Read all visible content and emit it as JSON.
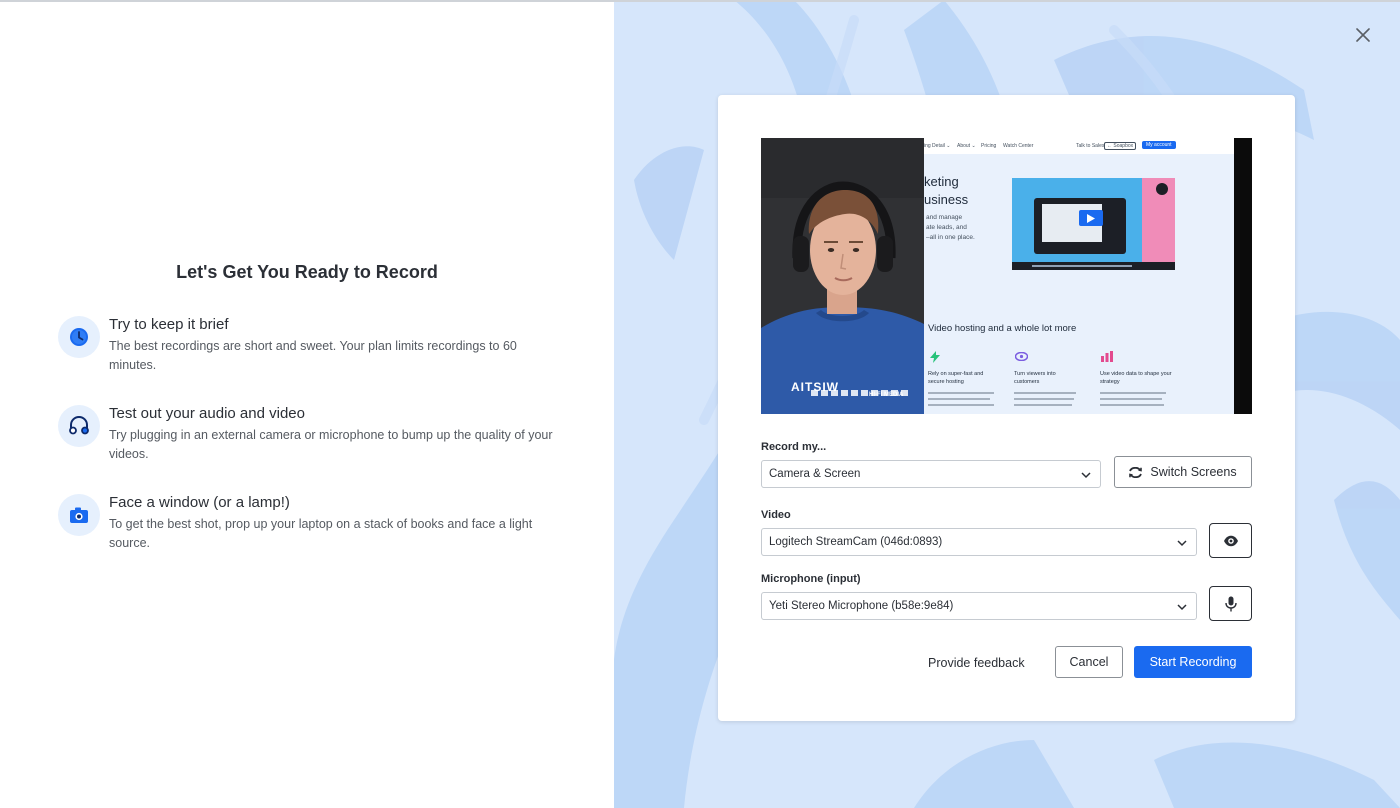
{
  "title": "Let's Get You Ready to Record",
  "tips": [
    {
      "icon": "clock-icon",
      "title": "Try to keep it brief",
      "description": "The best recordings are short and sweet. Your plan limits recordings to 60 minutes."
    },
    {
      "icon": "headphones-icon",
      "title": "Test out your audio and video",
      "description": "Try plugging in an external camera or microphone to bump up the quality of your videos."
    },
    {
      "icon": "camera-icon",
      "title": "Face a window (or a lamp!)",
      "description": "To get the best shot, prop up your laptop on a stack of books and face a light source."
    }
  ],
  "form": {
    "record_label": "Record my...",
    "record_value": "Camera & Screen",
    "switch_screens_label": "Switch Screens",
    "video_label": "Video",
    "video_value": "Logitech StreamCam (046d:0893)",
    "mic_label": "Microphone (input)",
    "mic_value": "Yeti Stereo Microphone (b58e:9e84)"
  },
  "actions": {
    "feedback": "Provide feedback",
    "cancel": "Cancel",
    "start": "Start Recording"
  },
  "preview": {
    "nav": [
      "ing Detail ⌄",
      "About ⌄",
      "Pricing",
      "Watch Center",
      "Talk to Sales",
      "← Soapbox",
      "My account"
    ],
    "headline_1": "keting",
    "headline_2": "usiness",
    "subline_1": "and manage",
    "subline_2": "ate leads, and",
    "subline_3": "–all in one place.",
    "section_title": "Video hosting and a whole lot more",
    "feature_1_title": "Rely on super-fast and secure hosting",
    "feature_2_title": "Turn viewers into customers",
    "feature_3_title": "Use video data to shape your strategy",
    "shirt_left": "AITSIW",
    "shirt_right": "HI-FI MEDIA"
  },
  "colors": {
    "accent": "#1a6af0",
    "panel_bg": "#d6e6fb",
    "icon_bg": "#e6f0fd"
  }
}
